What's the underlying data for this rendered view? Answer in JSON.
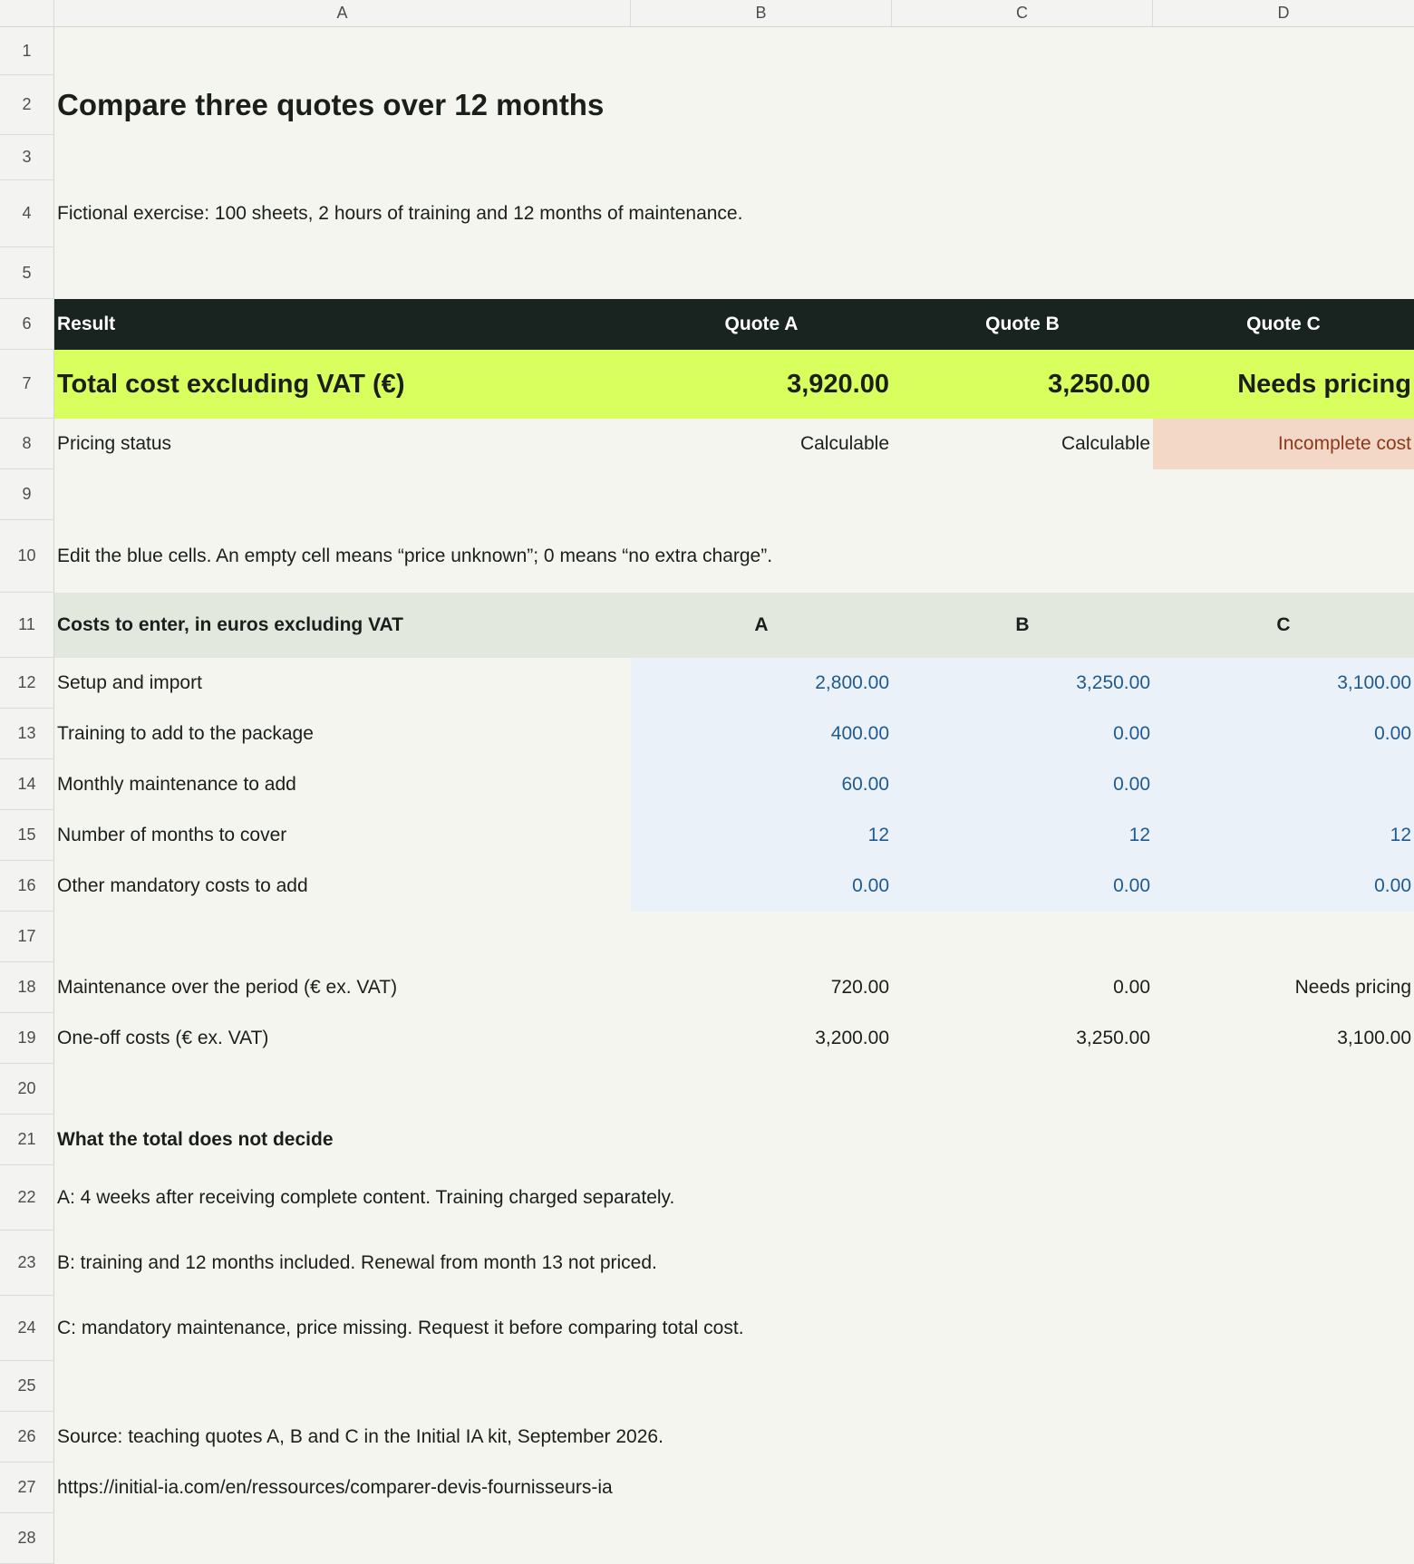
{
  "columns": [
    "A",
    "B",
    "C",
    "D"
  ],
  "row_numbers": [
    "1",
    "2",
    "3",
    "4",
    "5",
    "6",
    "7",
    "8",
    "9",
    "10",
    "11",
    "12",
    "13",
    "14",
    "15",
    "16",
    "17",
    "18",
    "19",
    "20",
    "21",
    "22",
    "23",
    "24",
    "25",
    "26",
    "27",
    "28"
  ],
  "title": "Compare three quotes over 12 months",
  "intro": "Fictional exercise: 100 sheets, 2 hours of training and 12 months of maintenance.",
  "result_header": {
    "label": "Result",
    "a": "Quote A",
    "b": "Quote B",
    "c": "Quote C"
  },
  "total_row": {
    "label": "Total cost excluding VAT (€)",
    "a": "3,920.00",
    "b": "3,250.00",
    "c": "Needs pricing"
  },
  "status_row": {
    "label": "Pricing status",
    "a": "Calculable",
    "b": "Calculable",
    "c": "Incomplete cost"
  },
  "instructions": "Edit the blue cells. An empty cell means “price unknown”; 0 means “no extra charge”.",
  "cost_header": {
    "label": "Costs to enter, in euros excluding VAT",
    "a": "A",
    "b": "B",
    "c": "C"
  },
  "inputs": [
    {
      "label": "Setup and import",
      "a": "2,800.00",
      "b": "3,250.00",
      "c": "3,100.00"
    },
    {
      "label": "Training to add to the package",
      "a": "400.00",
      "b": "0.00",
      "c": "0.00"
    },
    {
      "label": "Monthly maintenance to add",
      "a": "60.00",
      "b": "0.00",
      "c": ""
    },
    {
      "label": "Number of months to cover",
      "a": "12",
      "b": "12",
      "c": "12"
    },
    {
      "label": "Other mandatory costs to add",
      "a": "0.00",
      "b": "0.00",
      "c": "0.00"
    }
  ],
  "computed": [
    {
      "label": "Maintenance over the period (€ ex. VAT)",
      "a": "720.00",
      "b": "0.00",
      "c": "Needs pricing"
    },
    {
      "label": "One-off costs (€ ex. VAT)",
      "a": "3,200.00",
      "b": "3,250.00",
      "c": "3,100.00"
    }
  ],
  "notes_heading": "What the total does not decide",
  "notes": [
    "A: 4 weeks after receiving complete content. Training charged separately.",
    "B: training and 12 months included. Renewal from month 13 not priced.",
    "C: mandatory maintenance, price missing. Request it before comparing total cost."
  ],
  "source": "Source: teaching quotes A, B and C in the Initial IA kit, September 2026.",
  "url": "https://initial-ia.com/en/ressources/comparer-devis-fournisseurs-ia",
  "colors": {
    "background": "#f4f5ef",
    "header_dark": "#192320",
    "total_highlight": "#d9ff5f",
    "warning_fill": "#f3d7c7",
    "warning_text": "#8a3a1f",
    "input_fill": "#eaf1f8",
    "input_text": "#1f5b8e",
    "cost_header_fill": "#e3e8de"
  }
}
